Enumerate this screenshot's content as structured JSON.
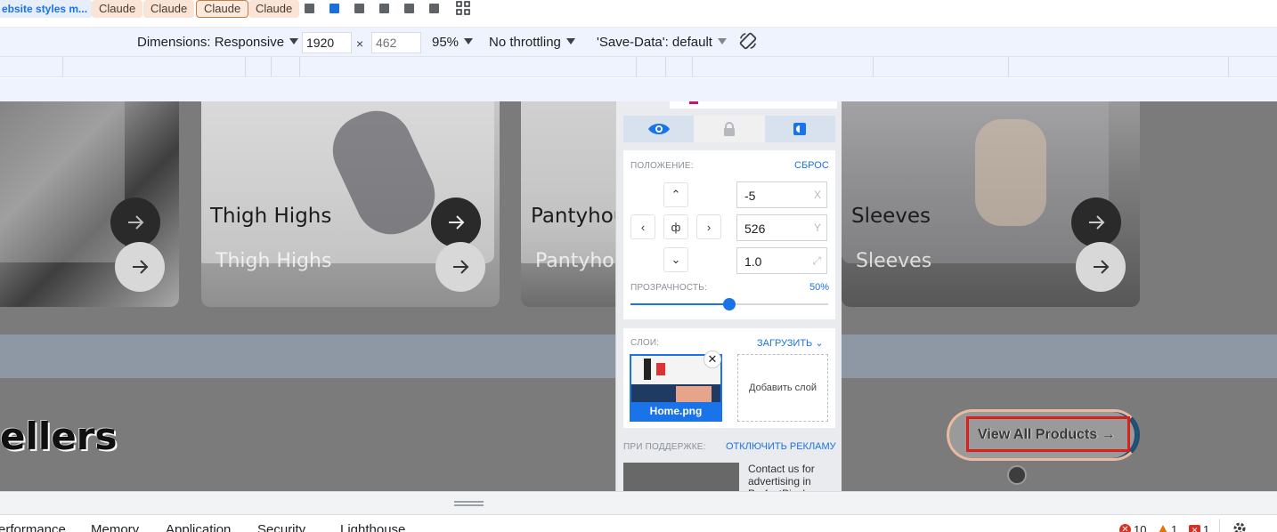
{
  "bookmarks": {
    "site_label": "ebsite styles m...",
    "chips": [
      "Claude",
      "Claude",
      "Claude",
      "Claude"
    ]
  },
  "device_toolbar": {
    "dimensions_label": "Dimensions: Responsive",
    "width_value": "1920",
    "height_placeholder": "462",
    "zoom": "95%",
    "throttling": "No throttling",
    "save_data": "'Save-Data': default"
  },
  "page": {
    "cards": [
      {
        "title": "",
        "title_ghost": ""
      },
      {
        "title": "Thigh Highs",
        "title_ghost": "Thigh Highs"
      },
      {
        "title": "Pantyhou",
        "title_ghost": "Pantyhou"
      },
      {
        "title": "Sleeves",
        "title_ghost": "Sleeves"
      }
    ],
    "bestsellers_heading": "ellers",
    "view_all_label": "View All Products →"
  },
  "overlay_panel": {
    "position_label": "ПОЛОЖЕНИЕ:",
    "reset_link": "СБРОС",
    "center_symbol": "ф",
    "x_value": "-5",
    "x_suffix": "X",
    "y_value": "526",
    "y_suffix": "Y",
    "scale_value": "1.0",
    "opacity_label": "ПРОЗРАЧНОСТЬ:",
    "opacity_value_text": "50%",
    "opacity_fraction": 0.5,
    "layers_label": "СЛОИ:",
    "upload_link": "ЗАГРУЗИТЬ",
    "layer_name": "Home.png",
    "add_layer": "Добавить слой",
    "support_label": "ПРИ ПОДДЕРЖКЕ:",
    "disable_ads_link": "ОТКЛЮЧИТЬ РЕКЛАМУ",
    "ad_text": "Contact us for advertising in PerfectPixel"
  },
  "devtools_tabs": [
    "erformance",
    "Memory",
    "Application",
    "Security",
    "Lighthouse"
  ],
  "status": {
    "errors": "10",
    "warnings": "1",
    "issues": "1"
  },
  "colors": {
    "accent": "#1a73e8",
    "chip_bg": "#f9e4d6",
    "error": "#d93025",
    "warning": "#e37400"
  }
}
